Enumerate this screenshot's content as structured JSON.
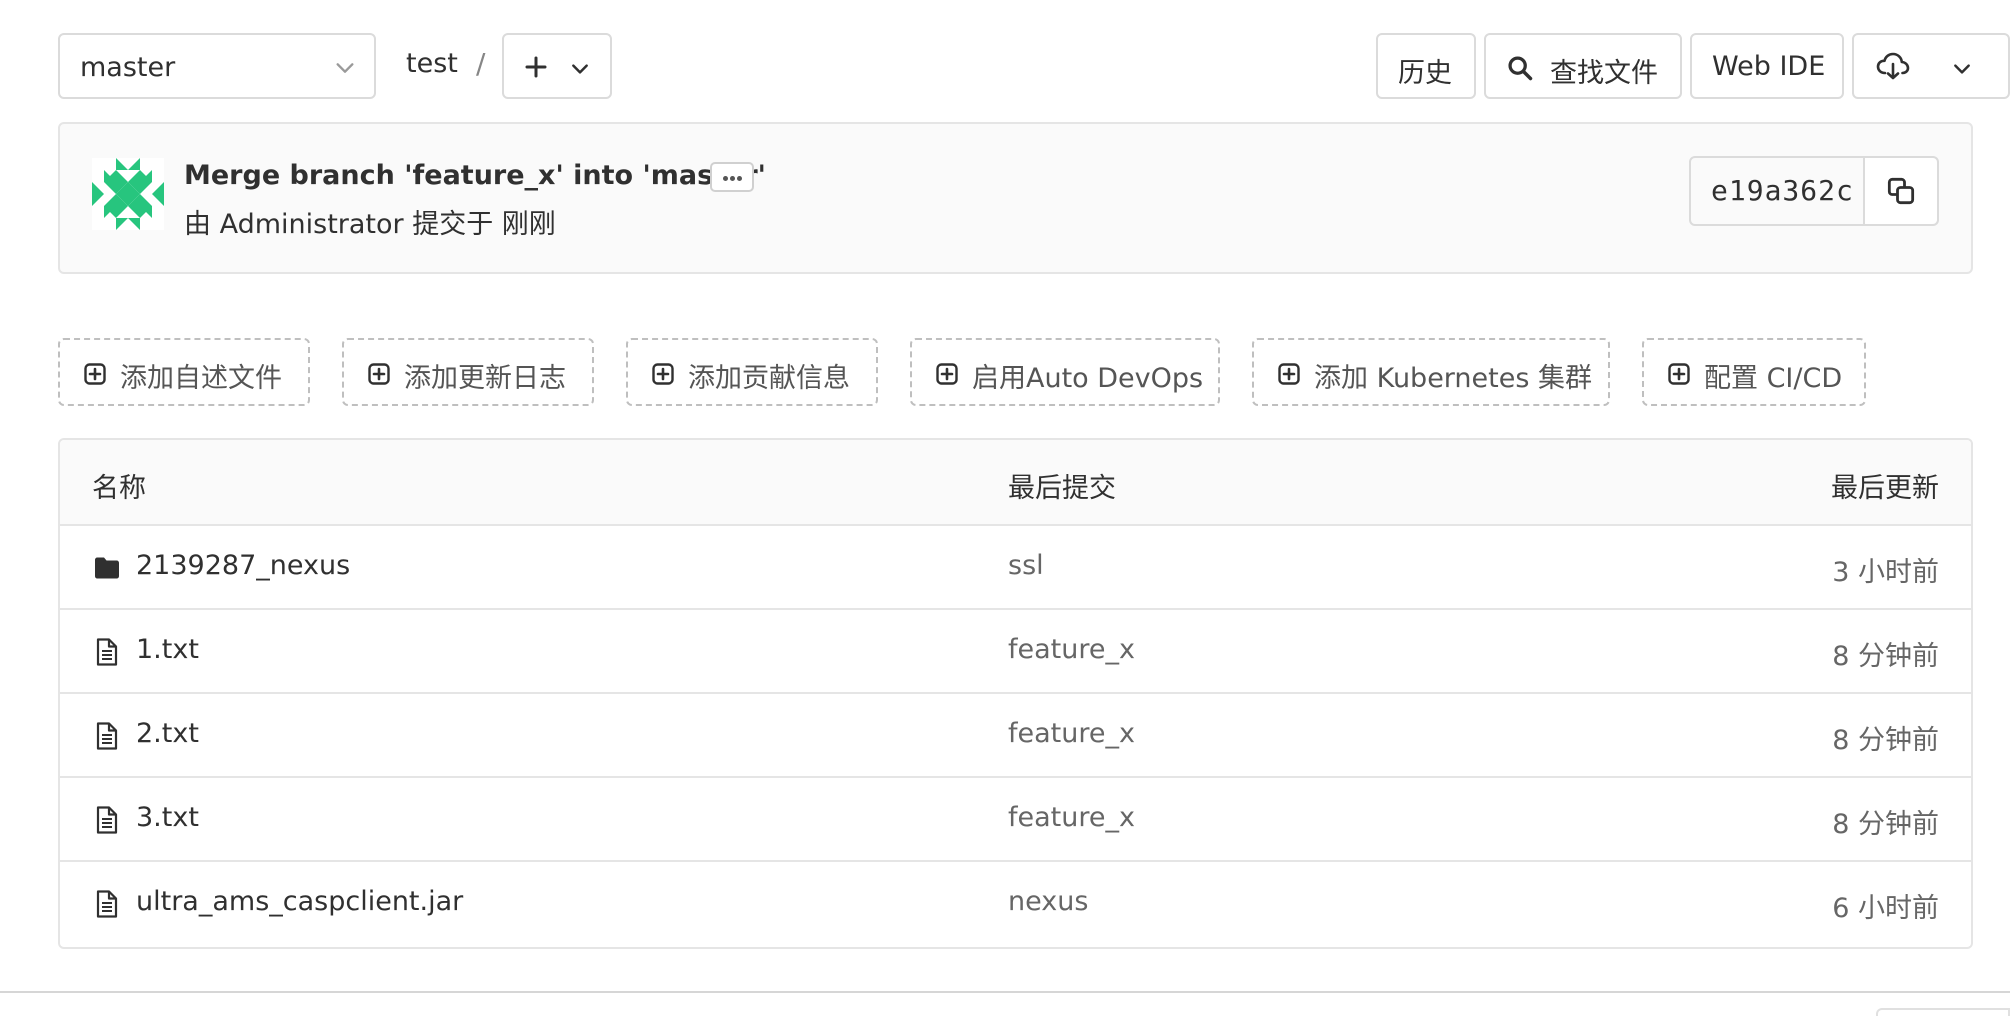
{
  "toolbar": {
    "branch": "master",
    "project": "test",
    "separator": "/",
    "history_label": "历史",
    "find_file_label": "查找文件",
    "web_ide_label": "Web IDE"
  },
  "commit": {
    "title": "Merge branch 'feature_x' into 'master'",
    "meta": "由 Administrator 提交于 刚刚",
    "sha": "e19a362c"
  },
  "actions": [
    {
      "label": "添加自述文件"
    },
    {
      "label": "添加更新日志"
    },
    {
      "label": "添加贡献信息"
    },
    {
      "label": "启用Auto DevOps"
    },
    {
      "label": "添加 Kubernetes 集群"
    },
    {
      "label": "配置 CI/CD"
    }
  ],
  "table": {
    "headers": {
      "name": "名称",
      "last_commit": "最后提交",
      "last_update": "最后更新"
    },
    "rows": [
      {
        "type": "folder",
        "name": "2139287_nexus",
        "commit": "ssl",
        "updated": "3 小时前"
      },
      {
        "type": "file",
        "name": "1.txt",
        "commit": "feature_x",
        "updated": "8 分钟前"
      },
      {
        "type": "file",
        "name": "2.txt",
        "commit": "feature_x",
        "updated": "8 分钟前"
      },
      {
        "type": "file",
        "name": "3.txt",
        "commit": "feature_x",
        "updated": "8 分钟前"
      },
      {
        "type": "file",
        "name": "ultra_ams_caspclient.jar",
        "commit": "nexus",
        "updated": "6 小时前"
      }
    ]
  },
  "colors": {
    "avatar_green": "#27c57e",
    "border": "#e5e5e5",
    "text": "#303030",
    "muted_text": "#666666"
  }
}
